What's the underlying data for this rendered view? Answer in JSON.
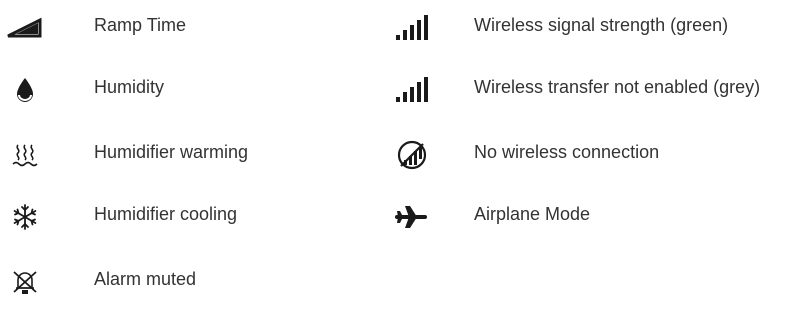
{
  "left_column": [
    {
      "icon": "ramp-time-icon",
      "label": "Ramp Time"
    },
    {
      "icon": "humidity-icon",
      "label": "Humidity"
    },
    {
      "icon": "humidifier-warming-icon",
      "label": "Humidifier warming"
    },
    {
      "icon": "humidifier-cooling-icon",
      "label": "Humidifier cooling"
    },
    {
      "icon": "alarm-muted-icon",
      "label": "Alarm muted"
    }
  ],
  "right_column": [
    {
      "icon": "wireless-signal-icon",
      "label": "Wireless signal strength (green)"
    },
    {
      "icon": "wireless-signal-icon",
      "label": "Wireless transfer not enabled (grey)"
    },
    {
      "icon": "no-wireless-connection-icon",
      "label": "No wireless connection"
    },
    {
      "icon": "airplane-icon",
      "label": "Airplane Mode"
    }
  ],
  "colors": {
    "icon": "#1a1a1a",
    "text": "#333333"
  }
}
